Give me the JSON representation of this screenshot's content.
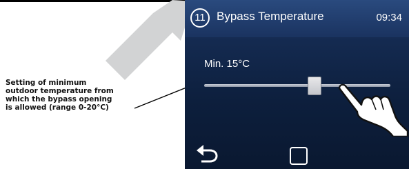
{
  "annotation": {
    "lines": [
      "Setting of minimum",
      "outdoor temperature from",
      "which the bypass opening",
      "is allowed (range 0-20°C)"
    ]
  },
  "screen": {
    "header": {
      "step_number": "11",
      "title": "Bypass Temperature",
      "time": "09:34"
    },
    "slider": {
      "label": "Min. 15°C",
      "value": 15,
      "min": 0,
      "max": 20,
      "unit": "°C"
    },
    "footer": {
      "back_icon": "back-arrow-icon",
      "home_icon": "square-home-icon"
    },
    "colors": {
      "background": "#142a50",
      "header": "#2a4a7e",
      "text": "#ffffff"
    }
  }
}
